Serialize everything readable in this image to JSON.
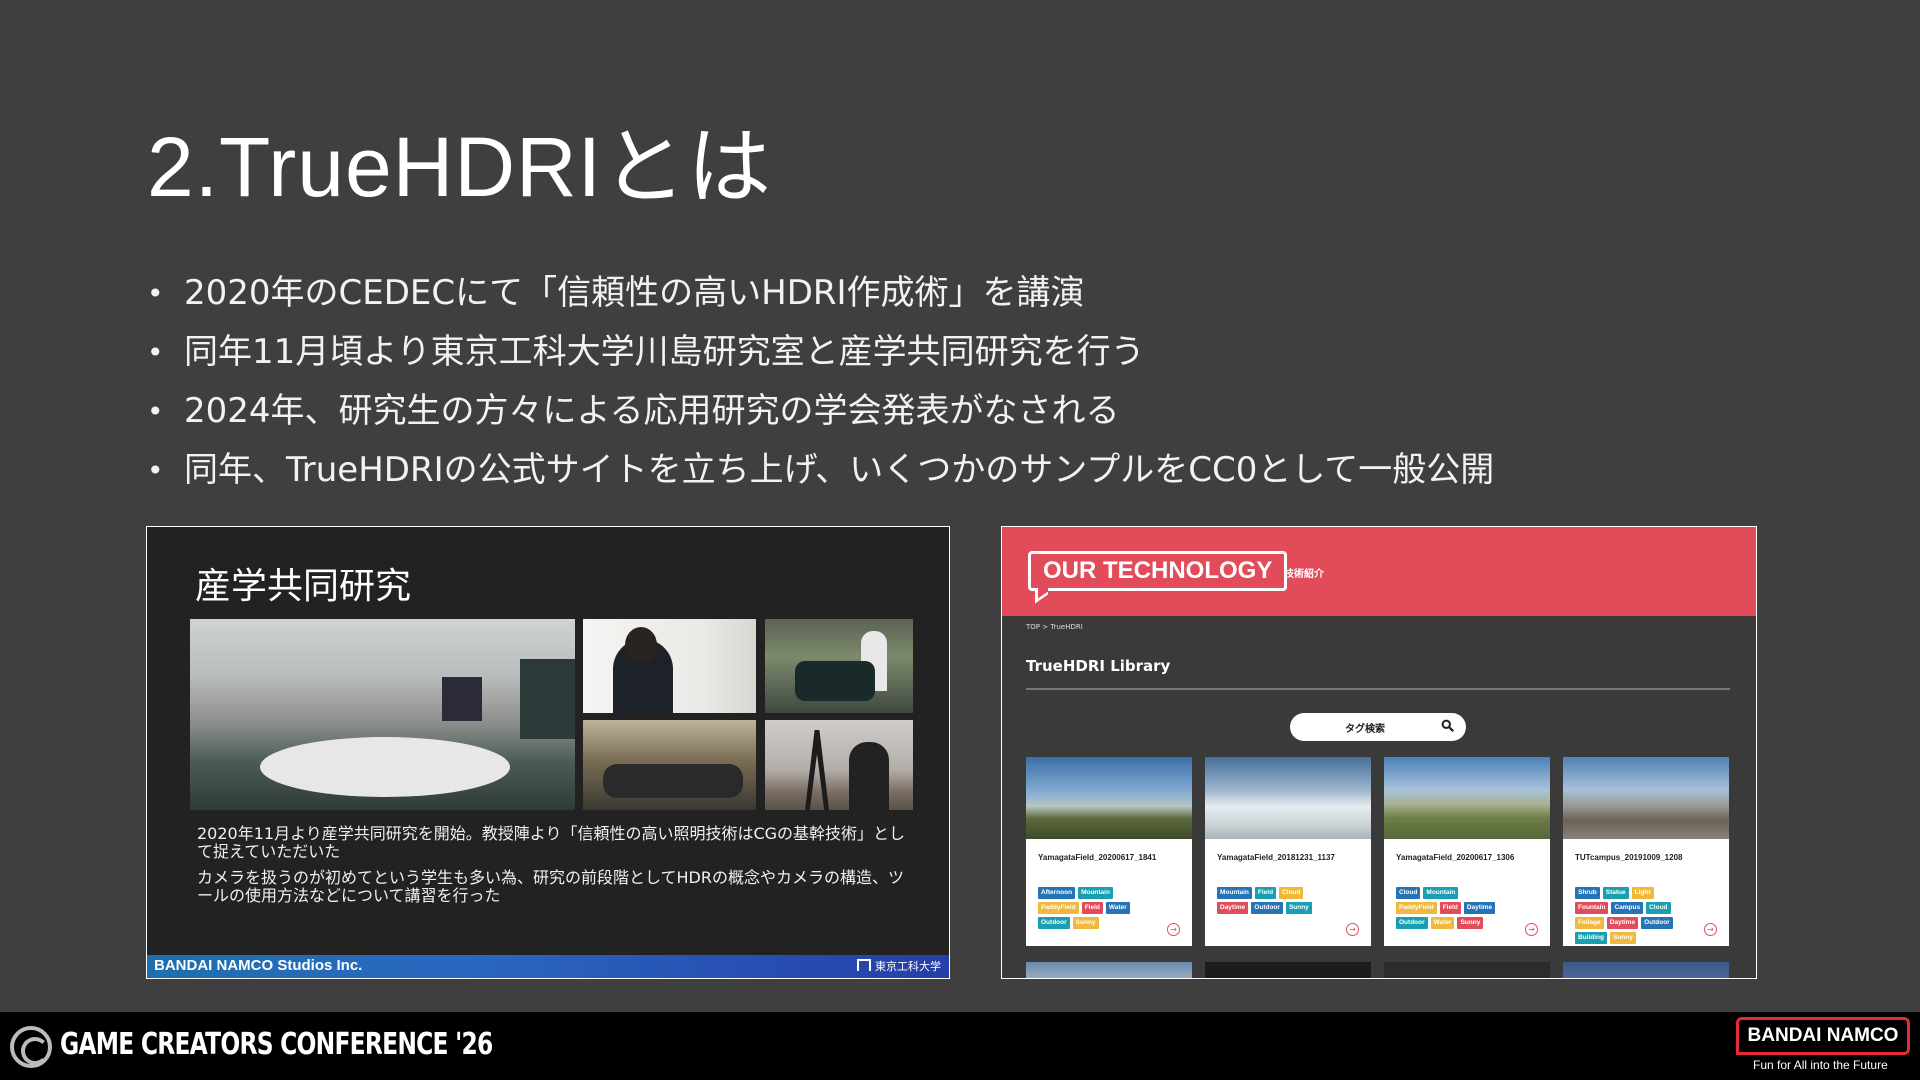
{
  "slide": {
    "title": "2.TrueHDRIとは",
    "bullets": [
      "2020年のCEDECにて「信頼性の高いHDRI作成術」を講演",
      "同年11月頃より東京工科大学川島研究室と産学共同研究を行う",
      "2024年、研究生の方々による応用研究の学会発表がなされる",
      "同年、TrueHDRIの公式サイトを立ち上げ、いくつかのサンプルをCC0として一般公開"
    ]
  },
  "left_panel": {
    "title": "産学共同研究",
    "text1": "2020年11月より産学共同研究を開始。教授陣より「信頼性の高い照明技術はCGの基幹技術」として捉えていただいた",
    "text2": "カメラを扱うのが初めてという学生も多い為、研究の前段階としてHDRの概念やカメラの構造、ツールの使用方法などについて講習を行った",
    "footer_company": "BANDAI NAMCO Studios Inc.",
    "footer_logo": "東京工科大学"
  },
  "right_panel": {
    "header_badge": "OUR TECHNOLOGY",
    "header_sub": "技術紹介",
    "breadcrumb": "TOP > TrueHDRI",
    "library_title": "TrueHDRI Library",
    "search_placeholder": "タグ検索",
    "cards": [
      {
        "title": "YamagataField_20200617_1841",
        "tags": [
          {
            "label": "Afternoon",
            "color": "blue"
          },
          {
            "label": "Mountain",
            "color": "teal"
          },
          {
            "label": "PaddyField",
            "color": "yellow"
          },
          {
            "label": "Field",
            "color": "red"
          },
          {
            "label": "Water",
            "color": "blue"
          },
          {
            "label": "Outdoor",
            "color": "teal"
          },
          {
            "label": "Sunny",
            "color": "yellow"
          }
        ]
      },
      {
        "title": "YamagataField_20181231_1137",
        "tags": [
          {
            "label": "Mountain",
            "color": "blue"
          },
          {
            "label": "Field",
            "color": "teal"
          },
          {
            "label": "Cloud",
            "color": "yellow"
          },
          {
            "label": "Daytime",
            "color": "red"
          },
          {
            "label": "Outdoor",
            "color": "blue"
          },
          {
            "label": "Sunny",
            "color": "teal"
          }
        ]
      },
      {
        "title": "YamagataField_20200617_1306",
        "tags": [
          {
            "label": "Cloud",
            "color": "blue"
          },
          {
            "label": "Mountain",
            "color": "teal"
          },
          {
            "label": "PaddyField",
            "color": "yellow"
          },
          {
            "label": "Field",
            "color": "red"
          },
          {
            "label": "Daytime",
            "color": "blue"
          },
          {
            "label": "Outdoor",
            "color": "teal"
          },
          {
            "label": "Water",
            "color": "yellow"
          },
          {
            "label": "Sunny",
            "color": "red"
          }
        ]
      },
      {
        "title": "TUTcampus_20191009_1208",
        "tags": [
          {
            "label": "Shrub",
            "color": "blue"
          },
          {
            "label": "Statue",
            "color": "teal"
          },
          {
            "label": "Light",
            "color": "yellow"
          },
          {
            "label": "Fountain",
            "color": "red"
          },
          {
            "label": "Campus",
            "color": "blue"
          },
          {
            "label": "Cloud",
            "color": "teal"
          },
          {
            "label": "Foliage",
            "color": "yellow"
          },
          {
            "label": "Daytime",
            "color": "red"
          },
          {
            "label": "Outdoor",
            "color": "blue"
          },
          {
            "label": "Building",
            "color": "teal"
          },
          {
            "label": "Sunny",
            "color": "yellow"
          }
        ]
      }
    ]
  },
  "footer": {
    "conference": "GAME CREATORS CONFERENCE '26",
    "brand": "BANDAI NAMCO",
    "tagline": "Fun for All into the Future"
  },
  "colors": {
    "background": "#3f3f3f",
    "accent_red": "#e24b5a",
    "footer_blue": "#2a67c0"
  }
}
